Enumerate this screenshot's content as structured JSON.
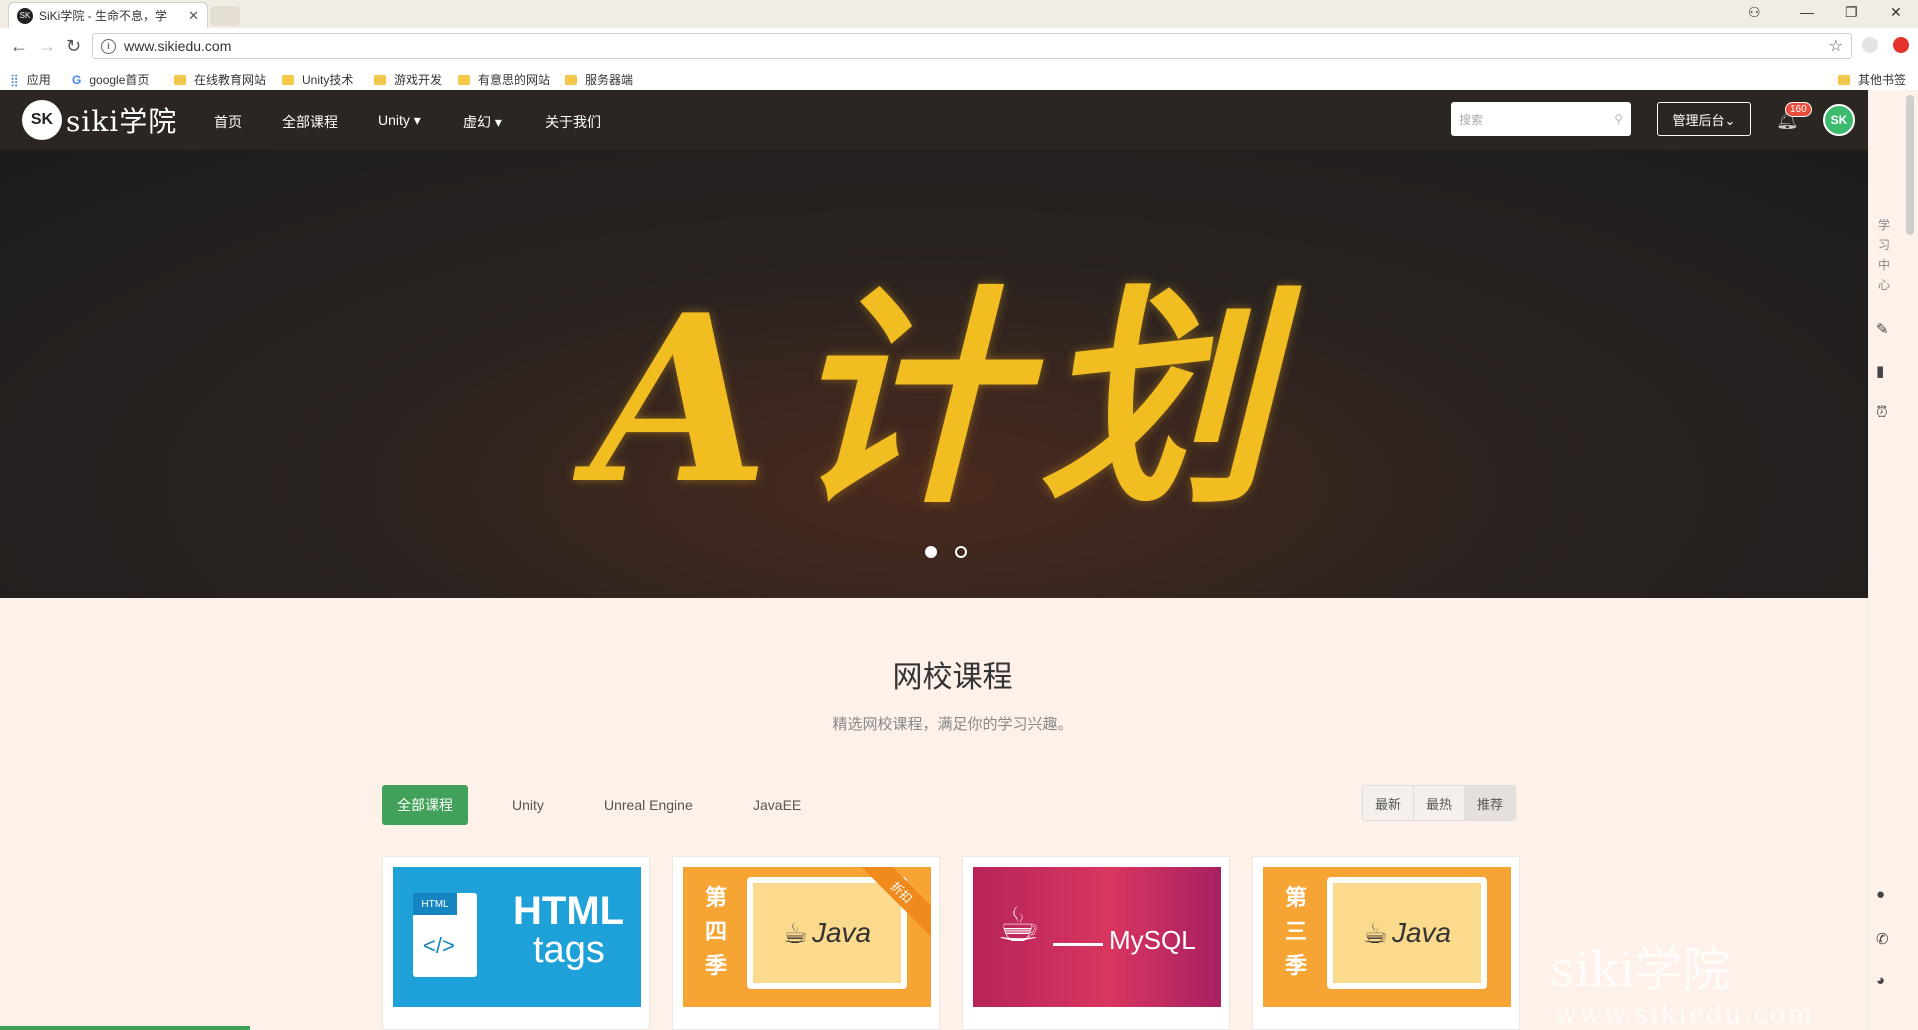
{
  "browser": {
    "tab_title": "SiKi学院 - 生命不息，学",
    "url": "www.sikiedu.com",
    "bookmarks": [
      "应用",
      "google首页",
      "在线教育网站",
      "Unity技术",
      "游戏开发",
      "有意思的网站",
      "服务器端"
    ],
    "other_bookmarks": "其他书签"
  },
  "site": {
    "logo_text": "siki学院",
    "logo_mark": "SK",
    "nav": [
      "首页",
      "全部课程",
      "Unity ▾",
      "虚幻 ▾",
      "关于我们"
    ],
    "search_placeholder": "搜索",
    "admin_label": "管理后台⌄",
    "notification_count": "160",
    "avatar_text": "SK"
  },
  "hero": {
    "headline": "A计划"
  },
  "side_label": "学习中心",
  "section": {
    "title": "网校课程",
    "subtitle": "精选网校课程，满足你的学习兴趣。",
    "filters": [
      "全部课程",
      "Unity",
      "Unreal Engine",
      "JavaEE"
    ],
    "sort": [
      "最新",
      "最热",
      "推荐"
    ]
  },
  "cards": [
    {
      "type": "html",
      "label_small": "HTML",
      "code": "</>",
      "title1": "HTML",
      "title2": "tags"
    },
    {
      "type": "java",
      "side": "第四季",
      "logo": "Java",
      "ribbon": "折扣"
    },
    {
      "type": "mysql",
      "logo": "MySQL"
    },
    {
      "type": "java",
      "side": "第三季",
      "logo": "Java"
    }
  ],
  "watermark": "siki学院",
  "watermark_url": "www.sikiedu.com"
}
